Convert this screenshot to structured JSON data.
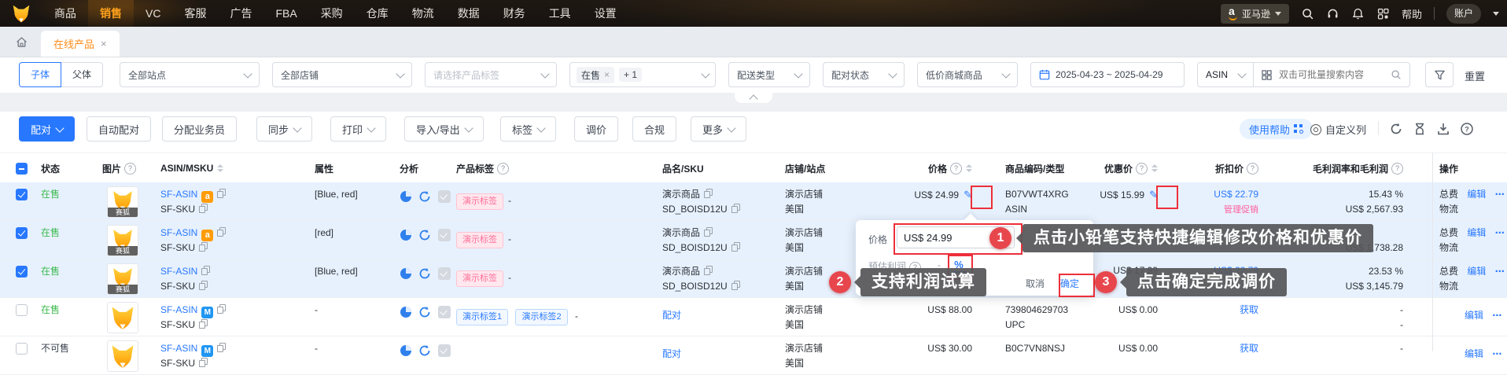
{
  "colors": {
    "accent_blue": "#2878ff",
    "annotation_red": "#ed2f3a",
    "nav_active_orange": "#ffa11b",
    "onsale_green": "#3dba4e",
    "tag_pink": "#ff6e97",
    "brand_orange": "#ffb300"
  },
  "icons": {
    "fox-logo": "fox head",
    "amazon-badge-icon": "a",
    "marketplace-badge-icon": "M",
    "more-icon": "⋯",
    "close-icon": "×",
    "edit-pencil-icon": "✎",
    "search-icon": "magnifier",
    "batch-search-icon": "grid",
    "calendar-icon": "calendar",
    "filter-icon": "funnel",
    "refresh-icon": "circular-arrow",
    "hourglass-icon": "hourglass",
    "download-icon": "down-arrow-tray",
    "help-circle-icon": "?",
    "gear-icon": "ring",
    "home-icon": "house",
    "bell-icon": "bell",
    "headset-icon": "headset",
    "apps-icon": "grid",
    "pie-chart-icon": "pie",
    "sync-icon": "circular-arrow",
    "check-icon": "checkmark",
    "collapse-icon": "chevron-up",
    "profit-calc-icon": "%"
  },
  "nav": {
    "items": [
      "商品",
      "销售",
      "VC",
      "客服",
      "广告",
      "FBA",
      "采购",
      "仓库",
      "物流",
      "数据",
      "财务",
      "工具",
      "设置"
    ],
    "active": "销售",
    "marketplace": "亚马逊",
    "amazon_a": "a",
    "help": "帮助",
    "account": "账户"
  },
  "tabs": {
    "active_tab": "在线产品"
  },
  "filters": {
    "scope_child": "子体",
    "scope_parent": "父体",
    "site": "全部站点",
    "shop": "全部店铺",
    "tag_placeholder": "请选择产品标签",
    "sale_chip": "在售",
    "sale_more": "+ 1",
    "delivery": "配送类型",
    "pairing": "配对状态",
    "low_price": "低价商城商品",
    "date_range": "2025-04-23 ~ 2025-04-29",
    "search_type": "ASIN",
    "search_placeholder": "双击可批量搜索内容",
    "reset": "重置"
  },
  "toolbar": {
    "pair": "配对",
    "auto_pair": "自动配对",
    "assign": "分配业务员",
    "sync": "同步",
    "print": "打印",
    "import_export": "导入/导出",
    "tag": "标签",
    "reprice": "调价",
    "compliance": "合规",
    "more": "更多",
    "usage_help": "使用帮助",
    "custom_columns": "自定义列"
  },
  "table": {
    "headers": {
      "status": "状态",
      "image": "图片",
      "asin_msku": "ASIN/MSKU",
      "attr": "属性",
      "analysis": "分析",
      "tags": "产品标签",
      "name_sku": "品名/SKU",
      "shop_site": "店铺/站点",
      "price": "价格",
      "code_type": "商品编码/类型",
      "discount": "优惠价",
      "discount_price": "折扣价",
      "profit": "毛利润率和毛利润",
      "ops": "操作"
    },
    "rows": [
      {
        "checked": true,
        "status": "在售",
        "img_badge": "赛狐",
        "asin": "SF-ASIN",
        "msku": "SF-SKU",
        "attr": "[Blue, red]",
        "tag": "演示标签",
        "tag_dash": "-",
        "name": "演示商品",
        "name_sku": "SD_BOISD12U",
        "shop": "演示店铺",
        "site": "美国",
        "price": "US$ 24.99",
        "code": "B07VWT4XRG",
        "code_type": "ASIN",
        "discount": "US$ 15.99",
        "discount_price": "US$ 22.79",
        "promo": "管理促销",
        "margin": "15.43 %",
        "profit": "US$ 2,567.93",
        "op_fee": "总费",
        "op_edit": "编辑",
        "op_logistics": "物流"
      },
      {
        "checked": true,
        "status": "在售",
        "img_badge": "赛狐",
        "asin": "SF-ASIN",
        "msku": "SF-SKU",
        "attr": "[red]",
        "tag": "演示标签",
        "tag_dash": "-",
        "name": "演示商品",
        "name_sku": "SD_BOISD12U",
        "shop": "演示店铺",
        "site": "美国",
        "profit": "US$ 1,738.28",
        "op_fee": "总费",
        "op_edit": "编辑",
        "op_logistics": "物流"
      },
      {
        "checked": true,
        "status": "在售",
        "img_badge": "赛狐",
        "asin": "SF-ASIN",
        "msku": "SF-SKU",
        "attr": "[Blue, red]",
        "tag": "演示标签",
        "tag_dash": "-",
        "name": "演示商品",
        "name_sku": "SD_BOISD12U",
        "shop": "演示店铺",
        "site": "美国",
        "discount": "US$ 17.99",
        "discount_price": "US$ 22.79",
        "margin": "23.53 %",
        "profit": "US$ 3,145.79",
        "op_fee": "总费",
        "op_edit": "编辑",
        "op_logistics": "物流"
      },
      {
        "checked": false,
        "status": "在售",
        "asin": "SF-ASIN",
        "msku": "SF-SKU",
        "attr": "-",
        "tag1": "演示标签1",
        "tag2": "演示标签2",
        "tag_dash": "-",
        "pair_link": "配对",
        "shop": "演示店铺",
        "site": "美国",
        "price": "US$ 88.00",
        "code": "739804629703",
        "code_type": "UPC",
        "discount": "US$ 0.00",
        "fetch": "获取",
        "margin": "-",
        "profit": "-",
        "op_edit": "编辑"
      },
      {
        "checked": false,
        "status": "不可售",
        "asin": "SF-ASIN",
        "msku": "SF-SKU",
        "attr": "-",
        "pair_link": "配对",
        "shop": "演示店铺",
        "site": "美国",
        "price": "US$ 30.00",
        "code": "B0C7VN8NSJ",
        "discount": "US$ 0.00",
        "fetch": "获取",
        "margin": "-",
        "op_edit": "编辑"
      }
    ]
  },
  "popup": {
    "price_label": "价格",
    "price_value": "US$ 24.99",
    "profit_label": "预估利润",
    "profit_value": "-",
    "cancel": "取消",
    "confirm": "确定"
  },
  "callouts": [
    {
      "num": "1",
      "text": "点击小铅笔支持快捷编辑修改价格和优惠价"
    },
    {
      "num": "2",
      "text": "支持利润试算"
    },
    {
      "num": "3",
      "text": "点击确定完成调价"
    }
  ]
}
